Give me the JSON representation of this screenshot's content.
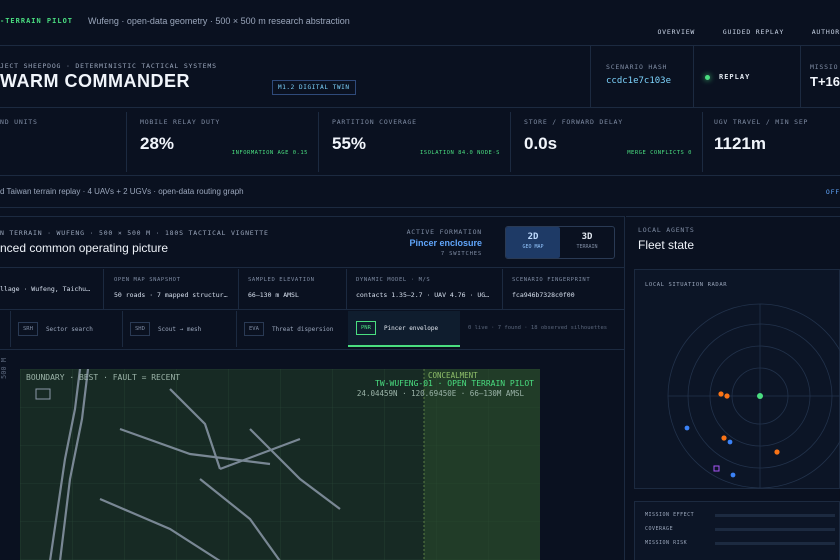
{
  "header": {
    "brand": "-TERRAIN PILOT",
    "subtitle": "Wufeng · open-data geometry · 500 × 500 m research abstraction",
    "nav": [
      "OVERVIEW",
      "GUIDED REPLAY",
      "AUTHOR"
    ]
  },
  "hero": {
    "project": "JECT SHEEPDOG · DETERMINISTIC TACTICAL SYSTEMS",
    "title": "WARM COMMANDER",
    "badge": "M1.2 DIGITAL TWIN",
    "hash_label": "SCENARIO HASH",
    "hash_value": "ccdc1e7c103e",
    "replay": "REPLAY",
    "mission_label": "MISSIO",
    "mission_value": "T+16"
  },
  "metrics": [
    {
      "label": "ND UNITS",
      "value": "",
      "sub": ""
    },
    {
      "label": "MOBILE RELAY DUTY",
      "value": "28%",
      "sub": "INFORMATION AGE 0.15"
    },
    {
      "label": "PARTITION COVERAGE",
      "value": "55%",
      "sub": "ISOLATION 84.0 NODE·S"
    },
    {
      "label": "STORE / FORWARD DELAY",
      "value": "0.0s",
      "sub": "MERGE CONFLICTS 0"
    },
    {
      "label": "UGV TRAVEL / MIN SEP",
      "value": "1121m",
      "sub": ""
    }
  ],
  "banner": {
    "text": "d Taiwan terrain replay · 4 UAVs + 2 UGVs · open-data routing graph",
    "right": "OFF"
  },
  "panel": {
    "kicker": "N TERRAIN · WUFENG · 500 × 500 M · 180S TACTICAL VIGNETTE",
    "title": "nced common operating picture",
    "formation_label": "ACTIVE FORMATION",
    "formation_value": "Pincer enclosure",
    "formation_sub": "7 SWITCHES",
    "view_2d": "2D",
    "view_2d_sub": "GEO MAP",
    "view_3d": "3D",
    "view_3d_sub": "TERRAIN"
  },
  "info": [
    {
      "label": "",
      "value": "llage · Wufeng, Taichu…"
    },
    {
      "label": "OPEN MAP SNAPSHOT",
      "value": "50 roads · 7 mapped structur…"
    },
    {
      "label": "SAMPLED ELEVATION",
      "value": "66–130 m AMSL"
    },
    {
      "label": "DYNAMIC MODEL · M/S",
      "value": "contacts 1.35–2.7 · UAV 4.76 · UG…"
    },
    {
      "label": "SCENARIO FINGERPRINT",
      "value": "fca946b7328c0f00"
    }
  ],
  "tabs": [
    {
      "code": "SRH",
      "label": "Sector search"
    },
    {
      "code": "SHD",
      "label": "Scout → mesh"
    },
    {
      "code": "EVA",
      "label": "Threat dispersion"
    },
    {
      "code": "PNR",
      "label": "Pincer envelope"
    }
  ],
  "tab_status": "0 live · 7 found · 18 observed silhouettes",
  "map": {
    "y_axis": "500 M",
    "legend": "BOUNDARY · BEST · FAULT = RECENT",
    "overlay_title": "TW-WUFENG-01 · OPEN TERRAIN PILOT",
    "overlay_coords": "24.04459N · 120.69450E · 66–130M AMSL",
    "concealment": "CONCEALMENT"
  },
  "agents": {
    "kicker": "LOCAL AGENTS",
    "title": "Fleet state",
    "radar_label": "LOCAL SITUATION RADAR",
    "stats": [
      "MISSION EFFECT",
      "COVERAGE",
      "MISSION RISK"
    ]
  },
  "colors": {
    "accent_green": "#4ade80",
    "accent_blue": "#60a5fa",
    "accent_orange": "#f97316",
    "bg": "#0a1120"
  }
}
